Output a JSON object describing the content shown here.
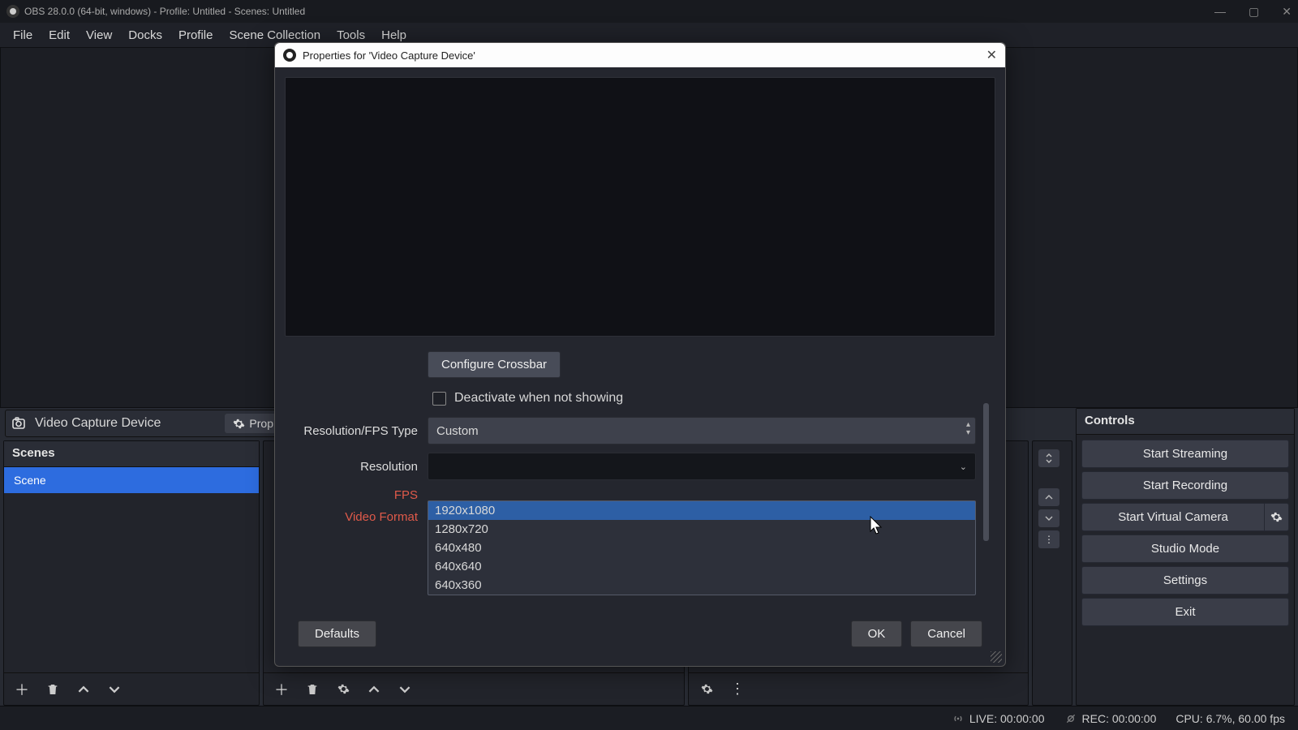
{
  "window_title": "OBS 28.0.0 (64-bit, windows) - Profile: Untitled - Scenes: Untitled",
  "menus": [
    "File",
    "Edit",
    "View",
    "Docks",
    "Profile",
    "Scene Collection",
    "Tools",
    "Help"
  ],
  "source_item": "Video Capture Device",
  "prop_button": "Prop",
  "scenes_header": "Scenes",
  "scene_name": "Scene",
  "controls_header": "Controls",
  "controls": {
    "start_streaming": "Start Streaming",
    "start_recording": "Start Recording",
    "start_vcam": "Start Virtual Camera",
    "studio_mode": "Studio Mode",
    "settings": "Settings",
    "exit": "Exit"
  },
  "status": {
    "live": "LIVE: 00:00:00",
    "rec": "REC: 00:00:00",
    "cpu": "CPU: 6.7%, 60.00 fps"
  },
  "dialog": {
    "title": "Properties for 'Video Capture Device'",
    "configure_crossbar": "Configure Crossbar",
    "deactivate_label": "Deactivate when not showing",
    "res_type_label": "Resolution/FPS Type",
    "res_type_value": "Custom",
    "resolution_label": "Resolution",
    "fps_label": "FPS",
    "video_format_label": "Video Format",
    "resolution_options": [
      "1920x1080",
      "1280x720",
      "640x480",
      "640x640",
      "640x360"
    ],
    "defaults": "Defaults",
    "ok": "OK",
    "cancel": "Cancel"
  }
}
